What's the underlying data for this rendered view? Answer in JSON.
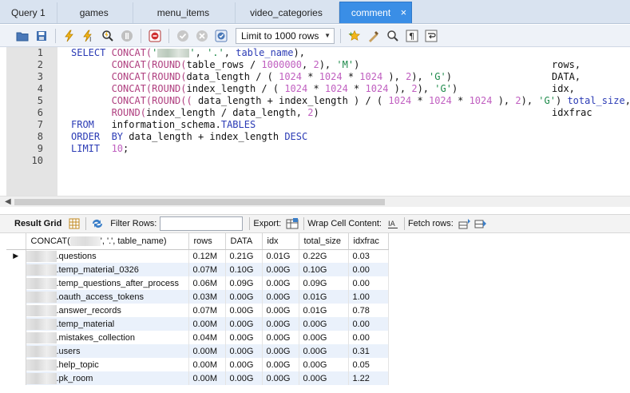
{
  "tabs": [
    {
      "label": "Query 1",
      "active": false
    },
    {
      "label": "games",
      "active": false
    },
    {
      "label": "menu_items",
      "active": false
    },
    {
      "label": "video_categories",
      "active": false
    },
    {
      "label": "comment",
      "active": true
    }
  ],
  "tab_close": "×",
  "toolbar": {
    "limit_label": "Limit to 1000 rows",
    "icons": [
      "folder-icon",
      "save-icon",
      "execute-icon",
      "execute-current-icon",
      "explain-icon",
      "stop-icon",
      "toggle-stop-on-error-icon",
      "commit-icon",
      "rollback-icon",
      "autocommit-icon",
      "add-favorite-icon",
      "beautify-icon",
      "find-icon",
      "invisible-chars-icon",
      "wrap-icon"
    ]
  },
  "editor": {
    "line_numbers": [
      "1",
      "2",
      "3",
      "4",
      "5",
      "6",
      "7",
      "8",
      "9",
      "10"
    ]
  },
  "result_bar": {
    "result_grid": "Result Grid",
    "filter_rows": "Filter Rows:",
    "export": "Export:",
    "wrap_cell": "Wrap Cell Content:",
    "fetch_rows": "Fetch rows:"
  },
  "grid": {
    "headers": [
      "CONCAT(",
      "', '.', table_name)",
      "rows",
      "DATA",
      "idx",
      "total_size",
      "idxfrac"
    ],
    "rows": [
      {
        "name": ".questions",
        "rows": "0.12M",
        "data": "0.21G",
        "idx": "0.01G",
        "total": "0.22G",
        "frac": "0.03"
      },
      {
        "name": ".temp_material_0326",
        "rows": "0.07M",
        "data": "0.10G",
        "idx": "0.00G",
        "total": "0.10G",
        "frac": "0.00"
      },
      {
        "name": ".temp_questions_after_process",
        "rows": "0.06M",
        "data": "0.09G",
        "idx": "0.00G",
        "total": "0.09G",
        "frac": "0.00"
      },
      {
        "name": ".oauth_access_tokens",
        "rows": "0.03M",
        "data": "0.00G",
        "idx": "0.00G",
        "total": "0.01G",
        "frac": "1.00"
      },
      {
        "name": ".answer_records",
        "rows": "0.07M",
        "data": "0.00G",
        "idx": "0.00G",
        "total": "0.01G",
        "frac": "0.78"
      },
      {
        "name": ".temp_material",
        "rows": "0.00M",
        "data": "0.00G",
        "idx": "0.00G",
        "total": "0.00G",
        "frac": "0.00"
      },
      {
        "name": ".mistakes_collection",
        "rows": "0.04M",
        "data": "0.00G",
        "idx": "0.00G",
        "total": "0.00G",
        "frac": "0.00"
      },
      {
        "name": ".users",
        "rows": "0.00M",
        "data": "0.00G",
        "idx": "0.00G",
        "total": "0.00G",
        "frac": "0.31"
      },
      {
        "name": ".help_topic",
        "rows": "0.00M",
        "data": "0.00G",
        "idx": "0.00G",
        "total": "0.00G",
        "frac": "0.05"
      },
      {
        "name": ".pk_room",
        "rows": "0.00M",
        "data": "0.00G",
        "idx": "0.00G",
        "total": "0.00G",
        "frac": "1.22"
      }
    ]
  }
}
